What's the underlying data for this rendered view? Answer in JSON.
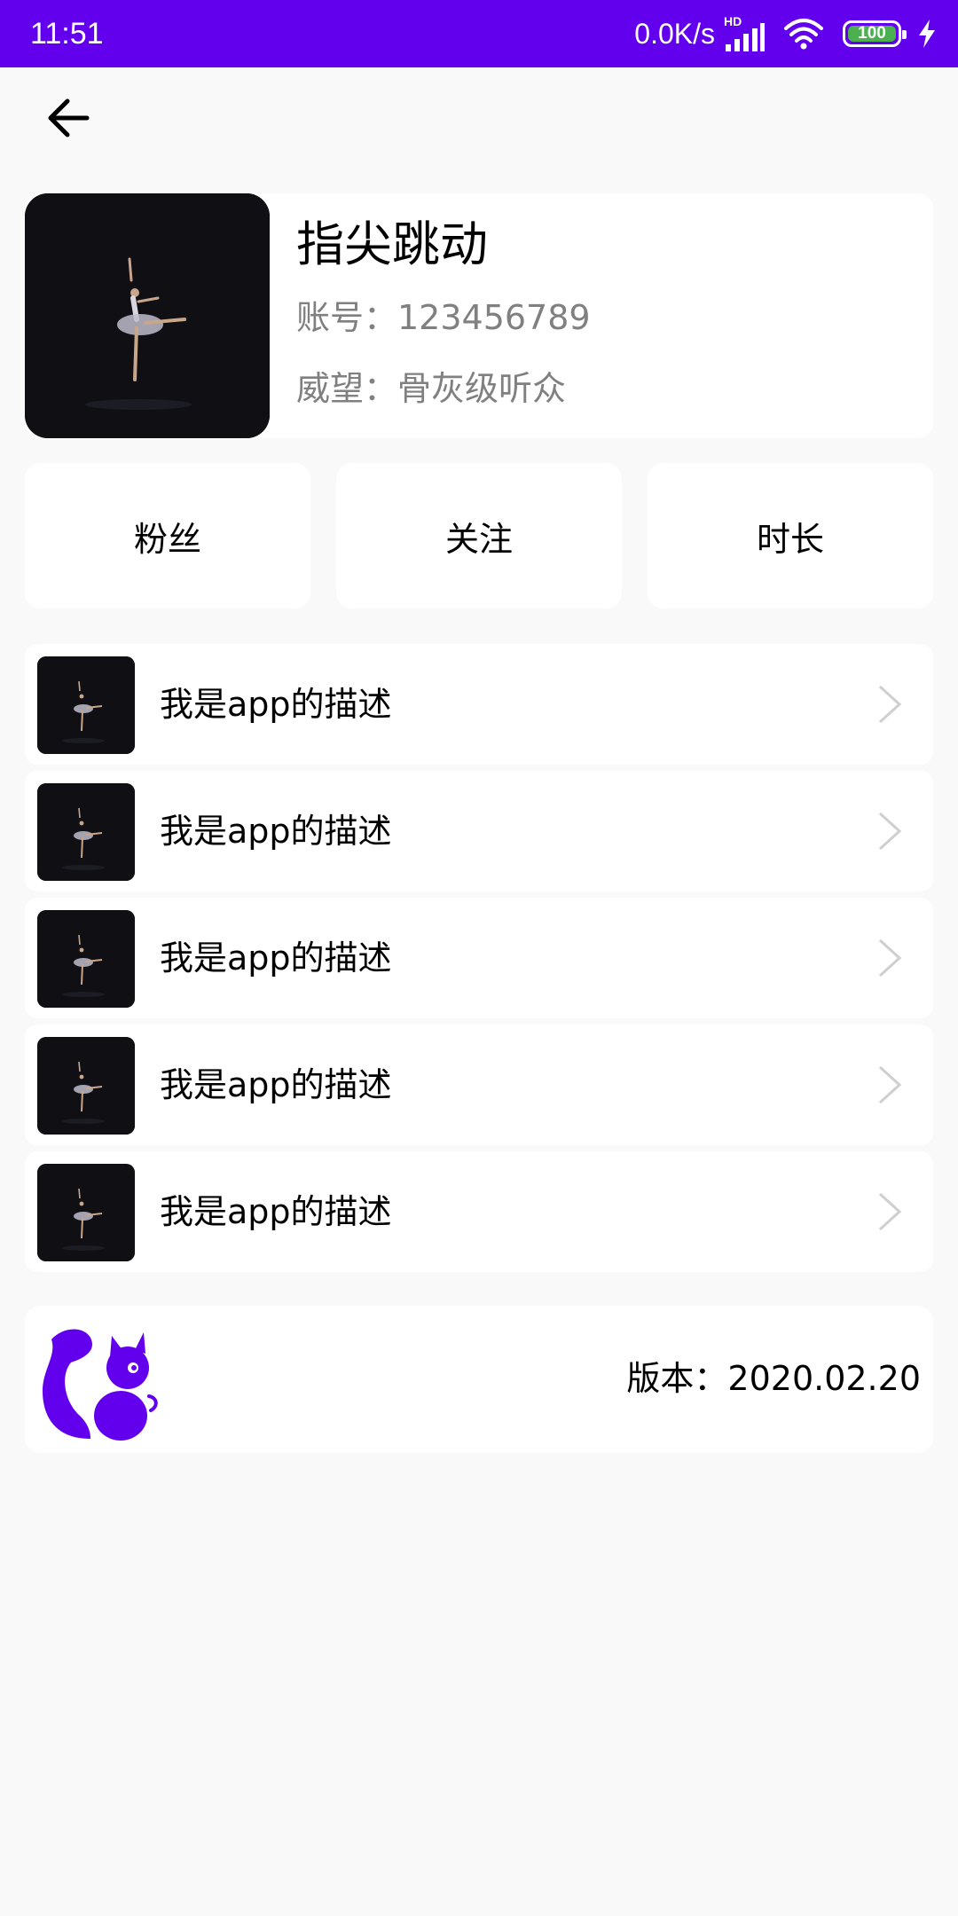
{
  "status_bar": {
    "time": "11:51",
    "net_speed": "0.0K/s",
    "network_label": "HD",
    "battery": "100",
    "accent_color": "#6200ee",
    "battery_color": "#4caf50",
    "icons": [
      "hd-signal-icon",
      "wifi-icon",
      "battery-icon",
      "charging-bolt-icon"
    ]
  },
  "header": {
    "back_icon": "arrow-left-icon"
  },
  "profile": {
    "name": "指尖跳动",
    "account": "账号：123456789",
    "rank": "威望：骨灰级听众",
    "avatar": "ballet-dancer-photo"
  },
  "stats": [
    {
      "label": "粉丝"
    },
    {
      "label": "关注"
    },
    {
      "label": "时长"
    }
  ],
  "list": {
    "items": [
      {
        "label": "我是app的描述"
      },
      {
        "label": "我是app的描述"
      },
      {
        "label": "我是app的描述"
      },
      {
        "label": "我是app的描述"
      },
      {
        "label": "我是app的描述"
      }
    ],
    "chevron_icon": "chevron-right-icon"
  },
  "footer": {
    "logo": "squirrel-logo",
    "logo_color": "#6200ee",
    "version": "版本：2020.02.20"
  }
}
